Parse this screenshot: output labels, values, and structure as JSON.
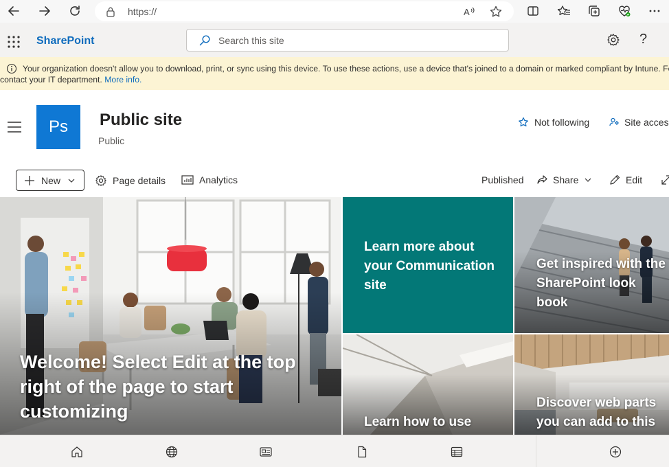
{
  "browser": {
    "url": "https://"
  },
  "suite": {
    "brand": "SharePoint",
    "search_placeholder": "Search this site"
  },
  "banner": {
    "message_line1": "Your organization doesn't allow you to download, print, or sync using this device. To use these actions, use a device that's joined to a domain or marked compliant by Intune. For h",
    "message_line2": "contact your IT department.",
    "link": "More info."
  },
  "site": {
    "logo_initials": "Ps",
    "title": "Public site",
    "subtitle": "Public",
    "follow_label": "Not following",
    "access_label": "Site access"
  },
  "command_bar": {
    "new_label": "New",
    "page_details_label": "Page details",
    "analytics_label": "Analytics",
    "published_label": "Published",
    "share_label": "Share",
    "edit_label": "Edit"
  },
  "hero": {
    "main_caption": "Welcome! Select Edit at the top right of the page to start customizing",
    "tile_learn_more": "Learn more about your Communication site",
    "tile_inspired": "Get inspired with the SharePoint look book",
    "tile_learn_how": "Learn how to use",
    "tile_discover": "Discover web parts you can add to this"
  },
  "colors": {
    "brand_blue": "#0f6cbd",
    "logo_blue": "#0f78d4",
    "teal_tile": "#037877",
    "banner_yellow": "#fcf4d4"
  },
  "icons": {
    "back": "back-arrow-icon",
    "forward": "forward-arrow-icon",
    "refresh": "refresh-icon",
    "lock": "lock-icon",
    "read_aloud": "read-aloud-icon",
    "favorite": "star-icon",
    "split": "split-screen-icon",
    "favorites": "favorites-icon",
    "collections": "collections-icon",
    "health": "browser-essentials-icon",
    "more": "more-icon",
    "waffle": "app-launcher-icon",
    "settings": "gear-icon",
    "help": "help-icon",
    "home": "home-icon",
    "globe": "globe-icon",
    "news": "news-icon",
    "file": "file-icon",
    "lists": "lists-icon",
    "add": "add-circle-icon"
  }
}
